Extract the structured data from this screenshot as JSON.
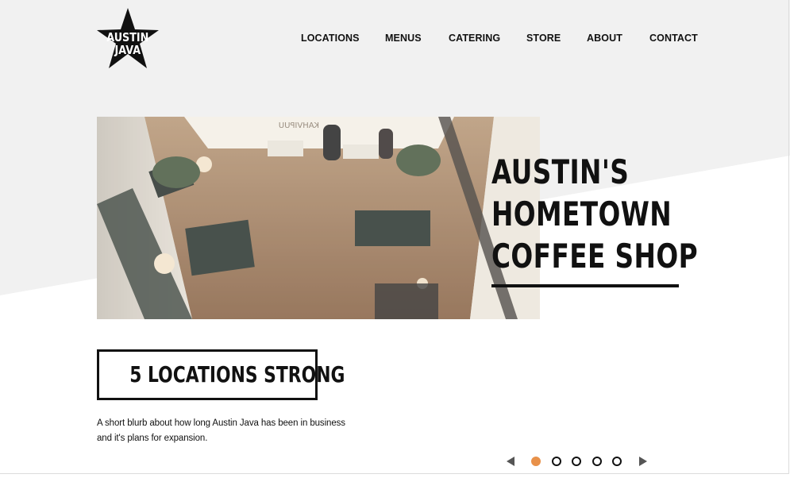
{
  "brand": {
    "logo_line1": "AUSTIN",
    "logo_line2": "JAVA"
  },
  "nav": {
    "items": [
      "LOCATIONS",
      "MENUS",
      "CATERING",
      "STORE",
      "ABOUT",
      "CONTACT"
    ]
  },
  "hero": {
    "headline": [
      "AUSTIN'S",
      "HOMETOWN",
      "COFFEE SHOP"
    ],
    "image_alt_sign": "KAHVIPUU"
  },
  "locations": {
    "badge": "5 LOCATIONS STRONG",
    "blurb": "A short blurb about how long Austin Java has been in business and it's plans for expansion."
  },
  "slider": {
    "count": 5,
    "active_index": 0,
    "active_color": "#e8914a"
  },
  "colors": {
    "accent": "#e8914a",
    "text": "#111111",
    "bg_band": "#f1f1f1"
  }
}
